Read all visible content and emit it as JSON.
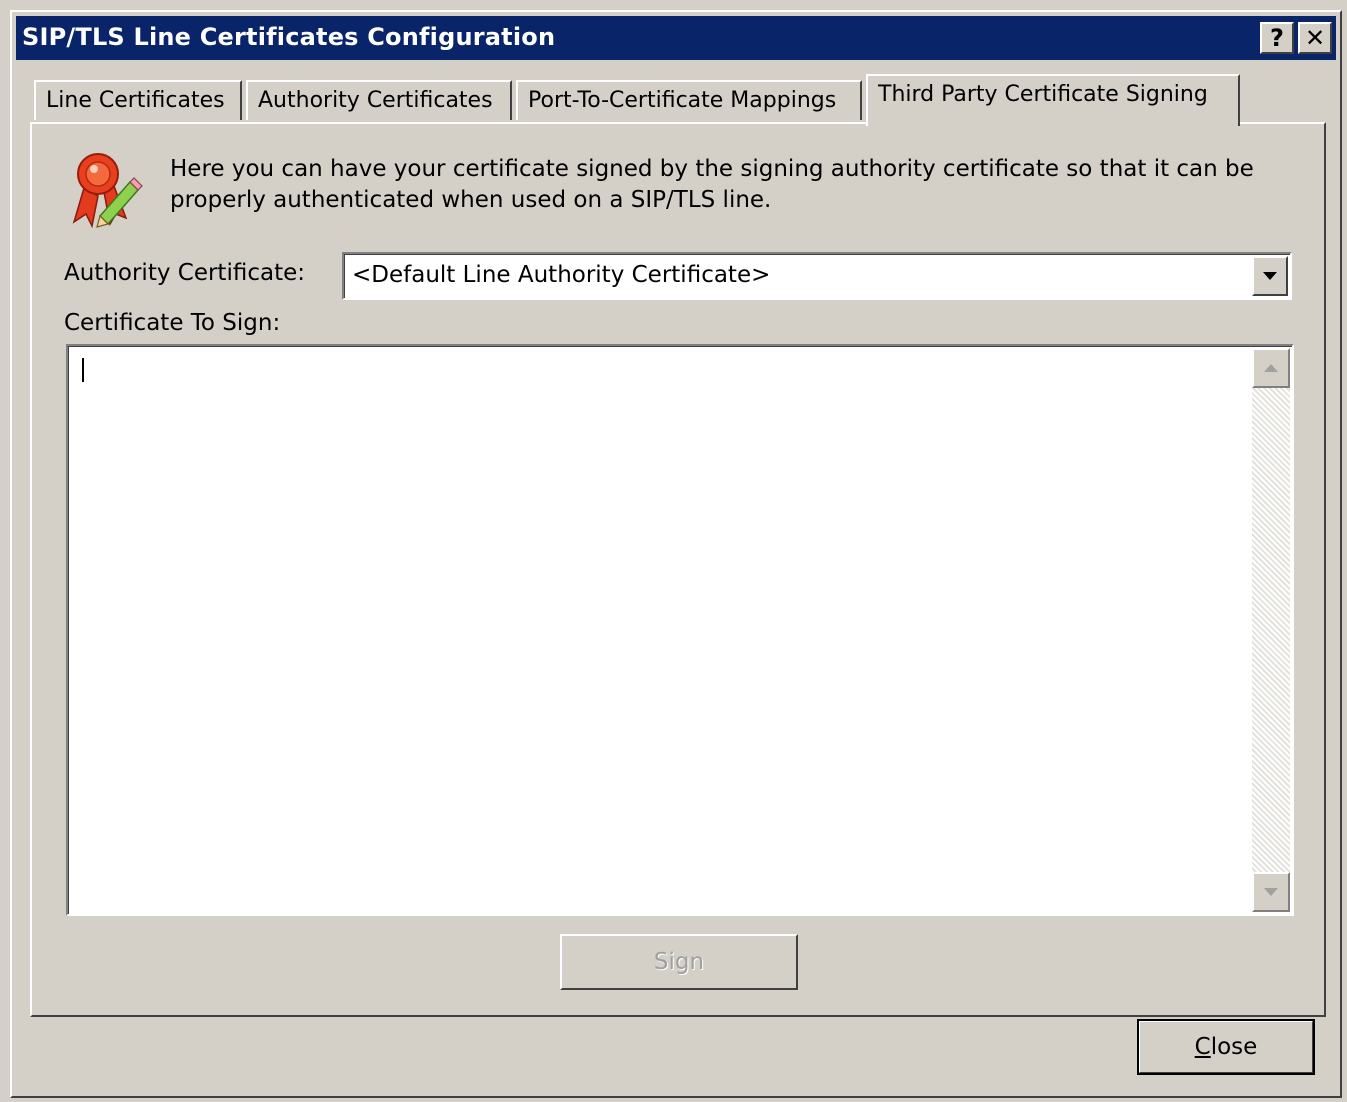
{
  "window": {
    "title": "SIP/TLS Line Certificates Configuration",
    "help_label": "?",
    "close_label": "✕"
  },
  "tabs": [
    {
      "label": "Line Certificates",
      "active": false
    },
    {
      "label": "Authority Certificates",
      "active": false
    },
    {
      "label": "Port-To-Certificate Mappings",
      "active": false
    },
    {
      "label": "Third Party Certificate Signing",
      "active": true
    }
  ],
  "panel": {
    "description": "Here you can have your certificate signed by the signing authority certificate so that it can be properly authenticated when used on a SIP/TLS line.",
    "icon": "certificate-ribbon-pencil-icon",
    "authority_label": "Authority Certificate:",
    "authority_value": "<Default Line Authority Certificate>",
    "cert_to_sign_label": "Certificate To Sign:",
    "cert_to_sign_value": "",
    "sign_button": "Sign"
  },
  "footer": {
    "close_button_mnemonic": "C",
    "close_button_rest": "lose"
  },
  "colors": {
    "titlebar": "#0a246a",
    "face": "#d4d0c8"
  }
}
